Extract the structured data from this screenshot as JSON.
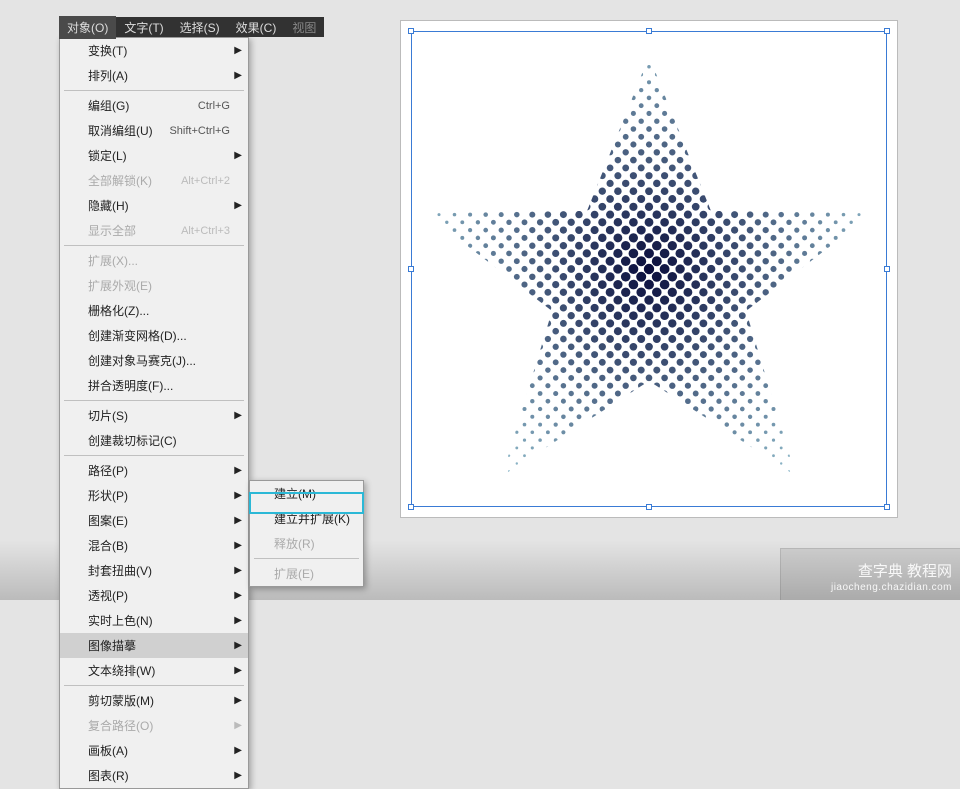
{
  "menubar": {
    "items": [
      {
        "label": "对象(O)",
        "active": true
      },
      {
        "label": "文字(T)"
      },
      {
        "label": "选择(S)"
      },
      {
        "label": "效果(C)"
      },
      {
        "label": "视图"
      }
    ]
  },
  "dropdown": {
    "groups": [
      [
        {
          "label": "变换(T)",
          "arrow": true
        },
        {
          "label": "排列(A)",
          "arrow": true
        }
      ],
      [
        {
          "label": "编组(G)",
          "shortcut": "Ctrl+G"
        },
        {
          "label": "取消编组(U)",
          "shortcut": "Shift+Ctrl+G"
        },
        {
          "label": "锁定(L)",
          "arrow": true
        },
        {
          "label": "全部解锁(K)",
          "shortcut": "Alt+Ctrl+2",
          "disabled": true
        },
        {
          "label": "隐藏(H)",
          "arrow": true
        },
        {
          "label": "显示全部",
          "shortcut": "Alt+Ctrl+3",
          "disabled": true
        }
      ],
      [
        {
          "label": "扩展(X)...",
          "disabled": true
        },
        {
          "label": "扩展外观(E)",
          "disabled": true
        },
        {
          "label": "栅格化(Z)..."
        },
        {
          "label": "创建渐变网格(D)..."
        },
        {
          "label": "创建对象马赛克(J)..."
        },
        {
          "label": "拼合透明度(F)..."
        }
      ],
      [
        {
          "label": "切片(S)",
          "arrow": true
        },
        {
          "label": "创建裁切标记(C)"
        }
      ],
      [
        {
          "label": "路径(P)",
          "arrow": true
        },
        {
          "label": "形状(P)",
          "arrow": true
        },
        {
          "label": "图案(E)",
          "arrow": true
        },
        {
          "label": "混合(B)",
          "arrow": true
        },
        {
          "label": "封套扭曲(V)",
          "arrow": true
        },
        {
          "label": "透视(P)",
          "arrow": true
        },
        {
          "label": "实时上色(N)",
          "arrow": true
        },
        {
          "label": "图像描摹",
          "arrow": true,
          "highlighted": true
        },
        {
          "label": "文本绕排(W)",
          "arrow": true
        }
      ],
      [
        {
          "label": "剪切蒙版(M)",
          "arrow": true
        },
        {
          "label": "复合路径(O)",
          "arrow": true,
          "disabled": true
        },
        {
          "label": "画板(A)",
          "arrow": true
        },
        {
          "label": "图表(R)",
          "arrow": true
        }
      ]
    ]
  },
  "submenu": {
    "items": [
      {
        "label": "建立(M)"
      },
      {
        "label": "建立并扩展(K)"
      },
      {
        "label": "释放(R)",
        "disabled": true
      },
      {
        "sep": true
      },
      {
        "label": "扩展(E)",
        "disabled": true
      }
    ]
  },
  "watermark": {
    "main": "查字典 教程网",
    "sub": "jiaocheng.chazidian.com"
  }
}
